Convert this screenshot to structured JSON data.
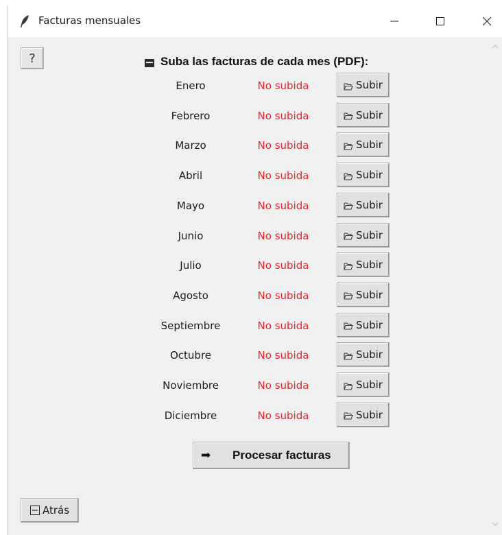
{
  "window": {
    "title": "Facturas mensuales",
    "title_icon": "feather-icon",
    "controls": [
      "minimize-icon",
      "maximize-icon",
      "close-icon"
    ]
  },
  "help": {
    "icon": "help-icon",
    "glyph": "?"
  },
  "header": {
    "icon": "folder-icon",
    "text": "Suba las facturas de cada mes (PDF):"
  },
  "months": [
    {
      "name": "Enero",
      "status": "No subida",
      "button": "Subir"
    },
    {
      "name": "Febrero",
      "status": "No subida",
      "button": "Subir"
    },
    {
      "name": "Marzo",
      "status": "No subida",
      "button": "Subir"
    },
    {
      "name": "Abril",
      "status": "No subida",
      "button": "Subir"
    },
    {
      "name": "Mayo",
      "status": "No subida",
      "button": "Subir"
    },
    {
      "name": "Junio",
      "status": "No subida",
      "button": "Subir"
    },
    {
      "name": "Julio",
      "status": "No subida",
      "button": "Subir"
    },
    {
      "name": "Agosto",
      "status": "No subida",
      "button": "Subir"
    },
    {
      "name": "Septiembre",
      "status": "No subida",
      "button": "Subir"
    },
    {
      "name": "Octubre",
      "status": "No subida",
      "button": "Subir"
    },
    {
      "name": "Noviembre",
      "status": "No subida",
      "button": "Subir"
    },
    {
      "name": "Diciembre",
      "status": "No subida",
      "button": "Subir"
    }
  ],
  "process": {
    "arrow": "➡",
    "label": "Procesar facturas"
  },
  "back": {
    "label": "Atrás"
  },
  "colors": {
    "status_not_uploaded": "#e8232c",
    "window_bg": "#f0f0f0",
    "button_bg": "#e1e1e1"
  }
}
